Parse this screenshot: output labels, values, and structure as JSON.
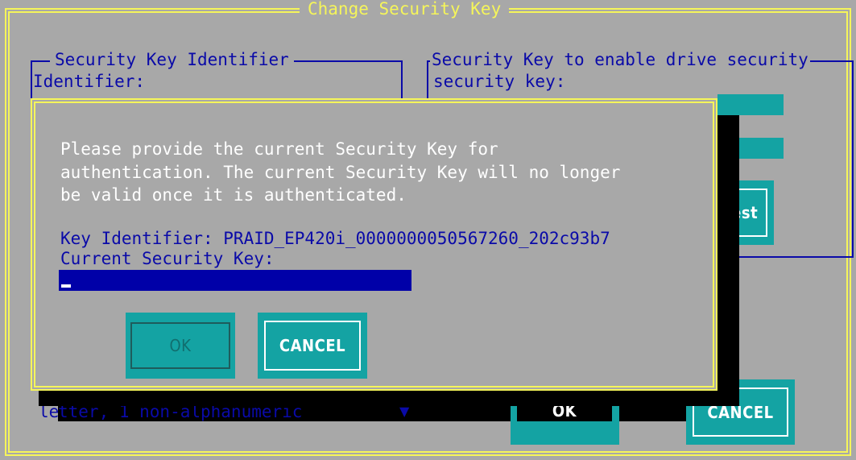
{
  "window": {
    "title": "Change Security Key"
  },
  "identifier_group": {
    "title": "Security Key Identifier",
    "label": "Identifier:"
  },
  "drive_security_group": {
    "title": "Security Key to enable drive security",
    "label": "security key:",
    "suggest_button_visible_text": "gest"
  },
  "background_hint": {
    "prefix": "le",
    "text": "tter, 1 non-alphanumeric",
    "arrow": "▼"
  },
  "footer_buttons": {
    "ok_label": "OK",
    "cancel_label": "CANCEL"
  },
  "dialog": {
    "message_lines": [
      "Please provide the current Security Key for",
      "authentication. The current Security Key will no longer",
      "be valid once it is authenticated."
    ],
    "key_identifier_line": "Key Identifier: PRAID_EP420i_0000000050567260_202c93b7",
    "current_key_label": "Current Security Key:",
    "current_key_value": "",
    "ok_label": "OK",
    "cancel_label": "CANCEL"
  },
  "colors": {
    "background": "#a8a8a8",
    "frame": "#f5f55a",
    "text": "#0a0aa8",
    "input": "#0000a8",
    "button": "#14a3a3"
  }
}
